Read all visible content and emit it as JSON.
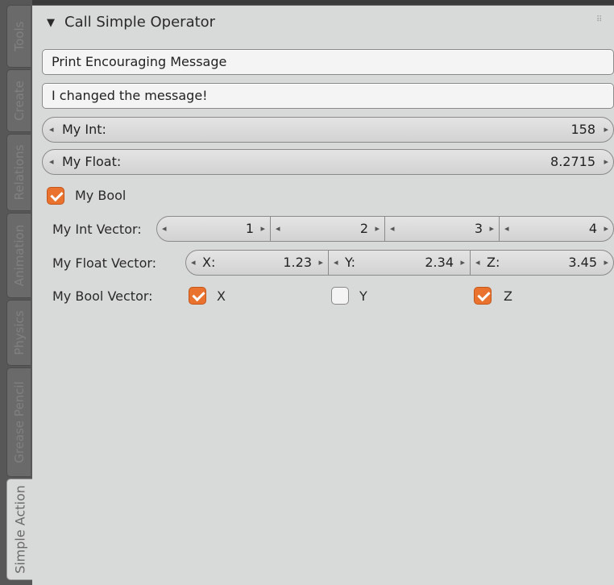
{
  "tabs": [
    {
      "label": "Tools",
      "active": false
    },
    {
      "label": "Create",
      "active": false
    },
    {
      "label": "Relations",
      "active": false
    },
    {
      "label": "Animation",
      "active": false
    },
    {
      "label": "Physics",
      "active": false
    },
    {
      "label": "Grease Pencil",
      "active": false
    },
    {
      "label": "Simple Action",
      "active": true
    }
  ],
  "panel": {
    "title": "Call Simple Operator",
    "collapse_icon": "▼",
    "grip_icon": "⠿"
  },
  "buttons": {
    "print_message": "Print Encouraging Message",
    "message_text": "I changed the message!"
  },
  "my_int": {
    "label": "My Int:",
    "value": "158"
  },
  "my_float": {
    "label": "My Float:",
    "value": "8.2715"
  },
  "my_bool": {
    "label": "My Bool",
    "checked": true
  },
  "int_vector": {
    "label": "My Int Vector:",
    "values": [
      "1",
      "2",
      "3",
      "4"
    ]
  },
  "float_vector": {
    "label": "My Float Vector:",
    "components": [
      {
        "label": "X:",
        "value": "1.23"
      },
      {
        "label": "Y:",
        "value": "2.34"
      },
      {
        "label": "Z:",
        "value": "3.45"
      }
    ]
  },
  "bool_vector": {
    "label": "My Bool Vector:",
    "components": [
      {
        "label": "X",
        "checked": true
      },
      {
        "label": "Y",
        "checked": false
      },
      {
        "label": "Z",
        "checked": true
      }
    ]
  },
  "arrows": {
    "left": "◂",
    "right": "▸"
  },
  "colors": {
    "accent": "#e9722f",
    "panel": "#d8dad9",
    "background": "#3a3a3a"
  }
}
